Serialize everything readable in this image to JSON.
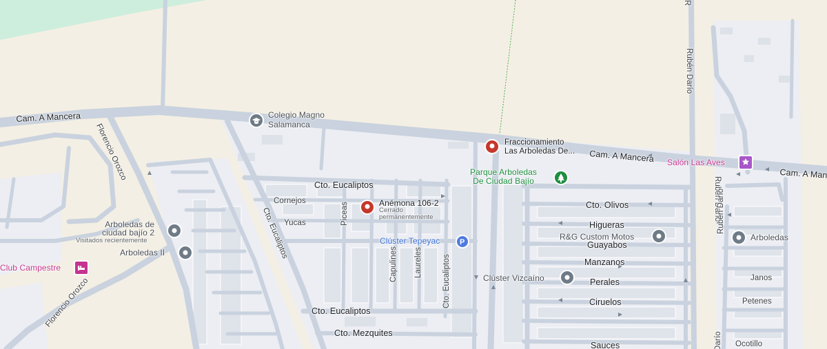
{
  "map": {
    "roads": {
      "main_road_left": "Cam. A Mancera",
      "main_road_mid": "Cam. A Mancera",
      "main_road_right": "Cam. A Mancera",
      "florencio_top": "Florencio Orozco",
      "florencio_bottom": "Florencio Orozco",
      "ruben_top": "Rubén Darío",
      "ruben_mid": "Rubén Darío",
      "ruben_right": "Rubén Darío",
      "ruben_bottom": "Darío",
      "cto_eucaliptos_top": "Cto. Eucaliptos",
      "cto_eucaliptos_diag": "Cto. Eucaliptos",
      "cto_eucaliptos_vert": "Cto. Eucaliptos",
      "cto_eucaliptos_bottom": "Cto. Eucaliptos",
      "cto_mezquites": "Cto. Mezquites",
      "cornejos": "Cornejos",
      "yucas": "Yucas",
      "piceas": "Piceas",
      "capulines": "Capulines",
      "laureles": "Laureles",
      "cto_olivos": "Cto. Olivos",
      "higueras": "Higueras",
      "guayabos": "Guayabos",
      "manzanos": "Manzanos",
      "perales": "Perales",
      "ciruelos": "Ciruelos",
      "sauces": "Sauces",
      "janos": "Janos",
      "petenes": "Petenes",
      "ocotillo": "Ocotillo"
    },
    "places": {
      "colegio_line1": "Colegio Magno",
      "colegio_line2": "Salamanca",
      "fracc_line1": "Fraccionamiento",
      "fracc_line2": "Las Arboledas De...",
      "parque_line1": "Parque Arboledas",
      "parque_line2": "De Ciudad Bajío",
      "salon": "Salón Las Aves",
      "anemona_name": "Anémona 106-2",
      "anemona_status1": "Cerrado",
      "anemona_status2": "permanentemente",
      "cluster_tepeyac": "Clúster Tepeyac",
      "cluster_vizcaino": "Clúster Vizcaíno",
      "rg_motos": "R&G Custom Motos",
      "arboledas_right": "Arboledas",
      "arboledas_cb2_line1": "Arboledas de",
      "arboledas_cb2_line2": "ciudad bajío 2",
      "arboledas_cb2_recent": "Visitados recientemente",
      "arboledas_ii": "Arboledas II",
      "club_campestre": "Club Campestre"
    },
    "colors": {
      "land": "#f4efe4",
      "residential": "#eceef3",
      "road": "#c9d2de",
      "park": "#cdeedc",
      "pin_red": "#c5372c",
      "pin_gray": "#6f7b86",
      "pin_green": "#1e8e3e",
      "pin_pink": "#c5348f",
      "pin_blue": "#4f7be0"
    }
  }
}
